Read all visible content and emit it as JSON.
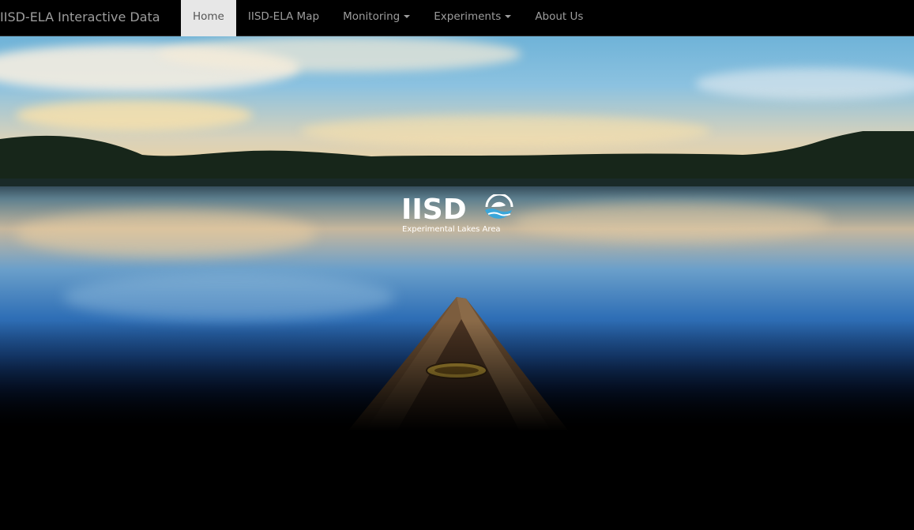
{
  "navbar": {
    "brand": "IISD-ELA Interactive Data",
    "items": [
      {
        "label": "Home",
        "active": true,
        "dropdown": false
      },
      {
        "label": "IISD-ELA Map",
        "active": false,
        "dropdown": false
      },
      {
        "label": "Monitoring",
        "active": false,
        "dropdown": true
      },
      {
        "label": "Experiments",
        "active": false,
        "dropdown": true
      },
      {
        "label": "About Us",
        "active": false,
        "dropdown": false
      }
    ]
  },
  "hero": {
    "logo": {
      "letters": "IISD",
      "subtitle": "Experimental Lakes Area"
    }
  },
  "colors": {
    "navbar_bg": "#000000",
    "nav_text": "#9d9d9d",
    "nav_active_bg": "#e7e7e7",
    "logo_mark_water": "#3aa6d9"
  }
}
